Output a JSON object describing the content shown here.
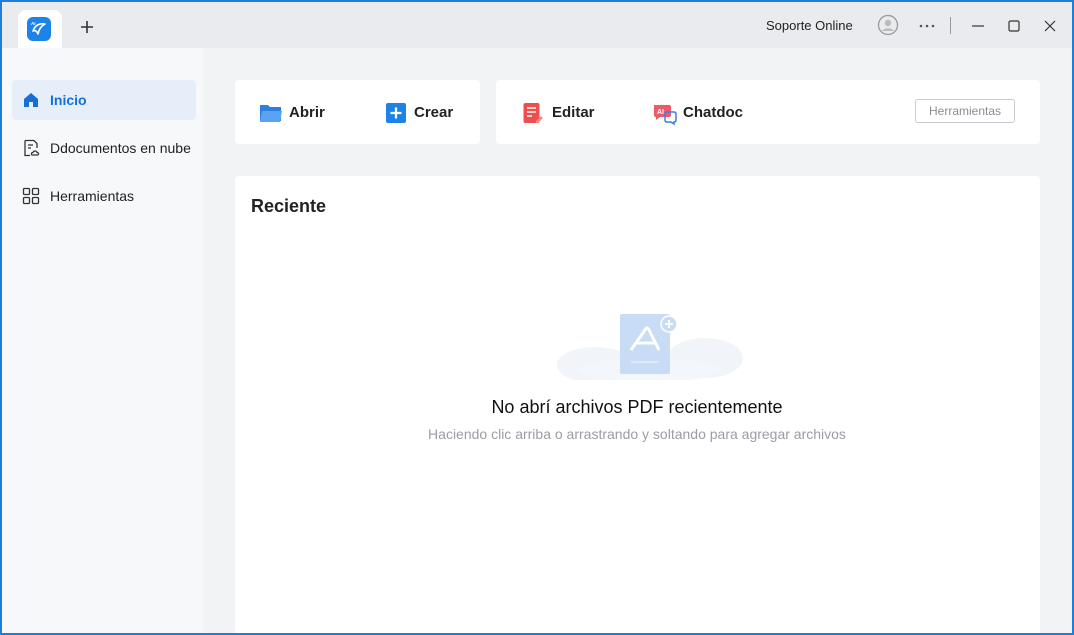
{
  "titlebar": {
    "support_label": "Soporte Online",
    "icons": [
      "app-logo-icon",
      "plus-icon",
      "user-icon",
      "more-icon",
      "minimize-icon",
      "maximize-icon",
      "close-icon"
    ]
  },
  "sidebar": {
    "items": [
      {
        "label": "Inicio",
        "icon": "home-icon",
        "active": true
      },
      {
        "label": "Ddocumentos en nube",
        "icon": "cloud-document-icon",
        "active": false
      },
      {
        "label": "Herramientas",
        "icon": "grid-icon",
        "active": false
      }
    ]
  },
  "actions": {
    "open_label": "Abrir",
    "create_label": "Crear",
    "edit_label": "Editar",
    "chatdoc_label": "Chatdoc",
    "chatdoc_badge": "AI",
    "tools_label": "Herramientas"
  },
  "recent": {
    "title": "Reciente",
    "empty_title": "No abrí archivos PDF recientemente",
    "empty_subtitle": "Haciendo clic arriba o arrastrando y soltando para agregar archivos"
  },
  "colors": {
    "accent": "#1c84e8",
    "active_nav_bg": "#e6eef9",
    "active_nav_text": "#1470d6",
    "edit_icon": "#ee4e4e",
    "chatdoc_icon": "#ef5a6b",
    "window_border": "#1e7fd8"
  }
}
